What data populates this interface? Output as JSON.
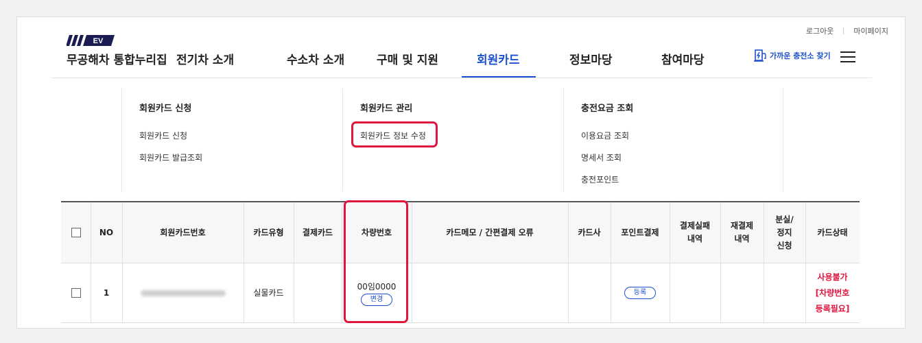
{
  "header": {
    "logo_badge": "EV",
    "logo_title": "무공해차 통합누리집",
    "util_links": [
      "로그아웃",
      "마이페이지"
    ],
    "nav": [
      "전기차 소개",
      "수소차 소개",
      "구매 및 지원",
      "회원카드",
      "정보마당",
      "참여마당"
    ],
    "active_nav": "회원카드",
    "find_label": "가까운 충전소 찾기"
  },
  "mega_menu": [
    {
      "title": "회원카드 신청",
      "links": [
        "회원카드 신청",
        "회원카드 발급조회"
      ]
    },
    {
      "title": "회원카드 관리",
      "links": [
        "회원카드 정보 수정"
      ]
    },
    {
      "title": "충전요금 조회",
      "links": [
        "이용요금 조회",
        "명세서 조회",
        "충전포인트"
      ]
    }
  ],
  "table": {
    "headers": [
      "NO",
      "회원카드번호",
      "카드유형",
      "결제카드",
      "차량번호",
      "카드메모 / 간편결제 오류",
      "카드사",
      "포인트결제",
      "결제실패 내역",
      "재결제 내역",
      "분실/ 정지 신청",
      "카드상태"
    ],
    "rows": [
      {
        "no": "1",
        "card_type": "실물카드",
        "vehicle_no": "00임0000",
        "change_button": "변경",
        "point_button": "등록",
        "status": "사용불가 [차량번호 등록필요]"
      }
    ]
  },
  "colors": {
    "accent": "#1a4fd1",
    "highlight": "#e0143c"
  }
}
